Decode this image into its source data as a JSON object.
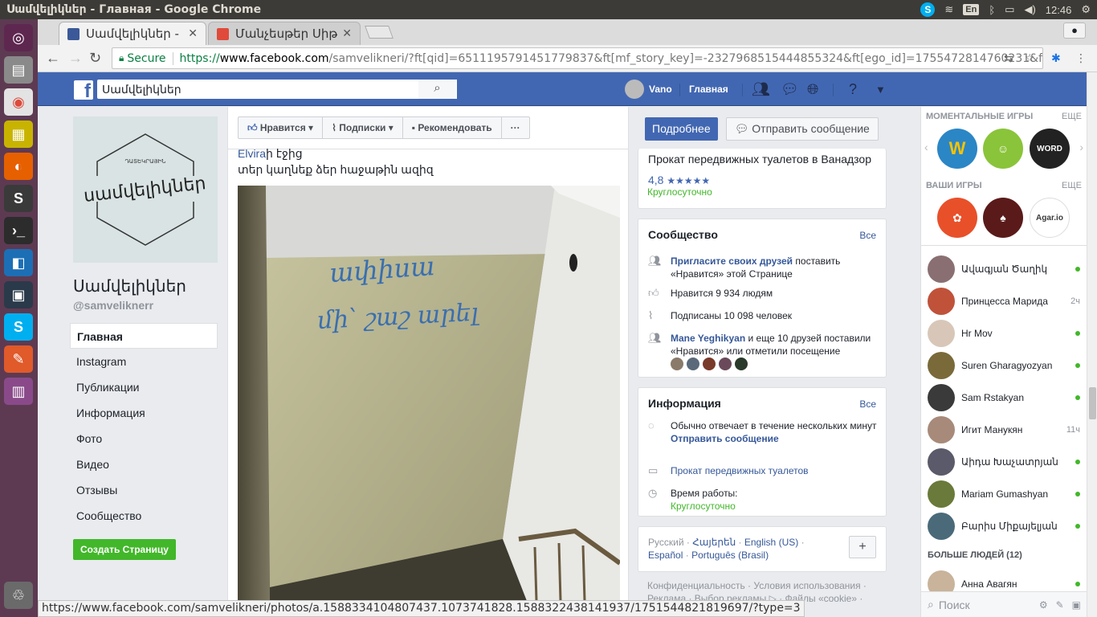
{
  "os": {
    "window_title": "Սամվելիկներ - Главная - Google Chrome",
    "keyboard_layout": "En",
    "clock": "12:46"
  },
  "browser": {
    "tabs": [
      {
        "label": "Սամվելիկներ - Гл",
        "active": true
      },
      {
        "label": "Մանչեսթեր Սիթ",
        "active": false
      }
    ],
    "secure_label": "Secure",
    "url_scheme": "https://",
    "url_host": "www.facebook.com",
    "url_path": "/samvelikneri/?ft[qid]=6511195791451779837&ft[mf_story_key]=-2327968515444855324&ft[ego_id]=1755472814760231&ft[ei]...",
    "status_url": "https://www.facebook.com/samvelikneri/photos/a.1588334104807437.1073741828.1588322438141937/1751544821819697/?type=3"
  },
  "fb_header": {
    "search_value": "Սամվելիկներ",
    "user_name": "Vano",
    "home_label": "Главная"
  },
  "page": {
    "logo_text": "սամվելիկներ",
    "logo_subtext": "ԴԱՏԵԿՐԱՅԻՆ",
    "name": "Սամվելիկներ",
    "handle": "@samveliknerr",
    "nav": [
      "Главная",
      "Instagram",
      "Публикации",
      "Информация",
      "Фото",
      "Видео",
      "Отзывы",
      "Сообщество"
    ],
    "create_page_label": "Создать Страницу"
  },
  "actions": {
    "like": "Нравится",
    "follow": "Подписки",
    "recommend": "Рекомендовать",
    "more": "···"
  },
  "post": {
    "author_link": "Elvira",
    "author_suffix": "ի էջից",
    "text": "տեր կաղնեք ձեր հաջաթին ազիզ",
    "graffiti_line1": "ափիսա",
    "graffiti_line2": "մի՝ շաշ արել"
  },
  "right": {
    "more_button": "Подробнее",
    "message_button": "Отправить сообщение",
    "business_title": "Прокат передвижных туалетов в Ванадзор",
    "rating": "4,8",
    "rating_stars": "★★★★★",
    "hours_badge": "Круглосуточно",
    "community": {
      "title": "Сообщество",
      "all": "Все",
      "invite_link": "Пригласите своих друзей",
      "invite_rest": "поставить «Нравится» этой Странице",
      "likes": "Нравится 9 934 людям",
      "followers": "Подписаны 10 098 человек",
      "friend_link": "Mane Yeghikyan",
      "friend_rest": "и еще 10 друзей поставили «Нравится» или отметили посещение"
    },
    "info": {
      "title": "Информация",
      "all": "Все",
      "response": "Обычно отвечает в течение нескольких минут",
      "send_message": "Отправить сообщение",
      "category": "Прокат передвижных туалетов",
      "hours_label": "Время работы:",
      "hours_value": "Круглосуточно"
    },
    "languages": {
      "current": "Русский",
      "sep": "·",
      "others": [
        "Հայերեն",
        "English (US)",
        "Español",
        "Português (Brasil)"
      ],
      "add": "+"
    },
    "footer_line1": "Конфиденциальность · Условия использования ·",
    "footer_line2": "Реклама · Выбор рекламы ▷ · Файлы «cookie» ·"
  },
  "chat": {
    "instant_games": "МОМЕНТАЛЬНЫЕ ИГРЫ",
    "your_games": "ВАШИ ИГРЫ",
    "more": "ЕЩЕ",
    "instant_game_icons": [
      "W",
      "☺",
      "WORD"
    ],
    "your_game_icons": [
      "✿",
      "♠",
      "Agar.io"
    ],
    "friends": [
      {
        "name": "Ավագյան Ծաղիկ",
        "status": "",
        "online": true,
        "color": "#8a6f72"
      },
      {
        "name": "Принцесса Марида",
        "status": "2ч",
        "online": false,
        "color": "#c0523a"
      },
      {
        "name": "Hr Mov",
        "status": "",
        "online": true,
        "color": "#d8c7b8"
      },
      {
        "name": "Suren Gharagyozyan",
        "status": "",
        "online": true,
        "color": "#7a6a3a"
      },
      {
        "name": "Sam Rstakyan",
        "status": "",
        "online": true,
        "color": "#3a3a3a"
      },
      {
        "name": "Игит Манукян",
        "status": "11ч",
        "online": false,
        "color": "#a88a7a"
      },
      {
        "name": "Աիդա Խաչատրյան",
        "status": "",
        "online": true,
        "color": "#5a5a6a"
      },
      {
        "name": "Mariam Gumashyan",
        "status": "",
        "online": true,
        "color": "#6a7a3a"
      },
      {
        "name": "Բարիս Միքայելյան",
        "status": "",
        "online": true,
        "color": "#4a6a7a"
      }
    ],
    "more_people": "БОЛЬШЕ ЛЮДЕЙ (12)",
    "more_friends": [
      {
        "name": "Анна Авагян",
        "status": "",
        "online": true,
        "color": "#c9b39a"
      }
    ],
    "search_placeholder": "Поиск"
  }
}
